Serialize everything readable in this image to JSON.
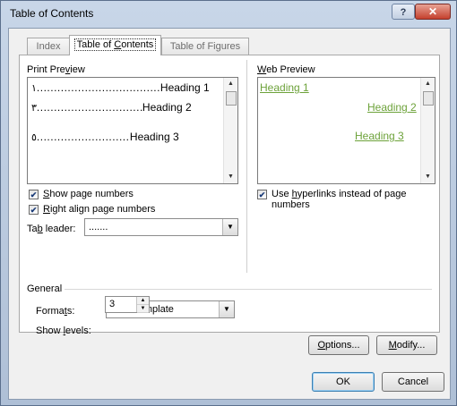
{
  "window": {
    "title": "Table of Contents",
    "help_glyph": "?",
    "close_glyph": "✕"
  },
  "tabs": [
    {
      "label": "Index"
    },
    {
      "label_pre": "Table of ",
      "label_key": "C",
      "label_post": "ontents"
    },
    {
      "label": "Table of Figures"
    }
  ],
  "print_preview": {
    "label_pre": "Print Pre",
    "label_key": "v",
    "label_post": "iew",
    "rows": [
      {
        "num": "١",
        "dots": "......................................",
        "text": "Heading 1"
      },
      {
        "num": "٣",
        "dots": "......................................",
        "text": "Heading 2"
      },
      {
        "num": "٥",
        "dots": "......................................",
        "text": "Heading 3"
      }
    ]
  },
  "web_preview": {
    "label_pre": "",
    "label_key": "W",
    "label_post": "eb Preview",
    "links": [
      "Heading 1",
      "Heading 2",
      "Heading 3"
    ],
    "link_color": "#6da23a"
  },
  "options_left": {
    "show_page_numbers": {
      "checked": true,
      "key": "S",
      "rest": "how page numbers"
    },
    "right_align": {
      "checked": true,
      "key": "R",
      "rest": "ight align page numbers"
    },
    "tab_leader": {
      "pre": "Ta",
      "key": "b",
      "post": " leader:",
      "value": "......."
    }
  },
  "options_right": {
    "use_hyperlinks": {
      "checked": true,
      "pre": "Use ",
      "key": "h",
      "post": "yperlinks instead of page numbers"
    }
  },
  "general": {
    "heading": "General",
    "formats": {
      "pre": "Forma",
      "key": "t",
      "post": "s:",
      "value": "From template"
    },
    "show_levels": {
      "pre": "Show ",
      "key": "l",
      "post": "evels:",
      "value": "3"
    }
  },
  "buttons": {
    "options": {
      "key": "O",
      "rest": "ptions..."
    },
    "modify": {
      "key": "M",
      "rest": "odify..."
    },
    "ok": "OK",
    "cancel": "Cancel"
  },
  "check_glyph": "✔"
}
